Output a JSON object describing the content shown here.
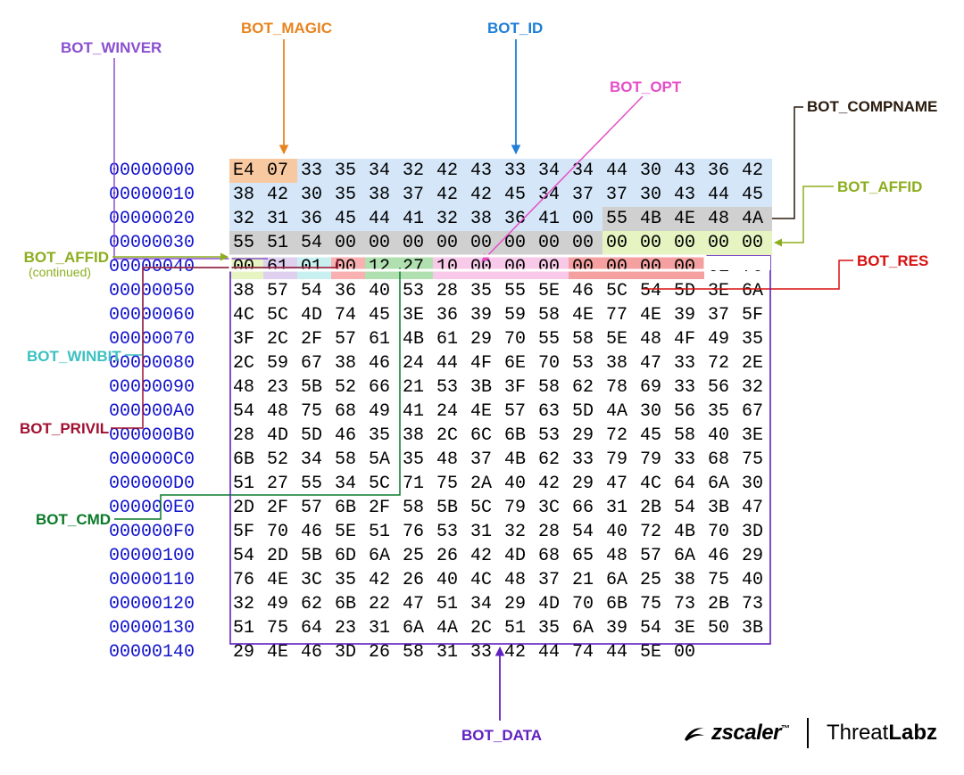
{
  "labels": {
    "bot_magic": "BOT_MAGIC",
    "bot_id": "BOT_ID",
    "bot_winver": "BOT_WINVER",
    "bot_opt": "BOT_OPT",
    "bot_compname": "BOT_COMPNAME",
    "bot_affid": "BOT_AFFID",
    "bot_affid2": "BOT_AFFID",
    "bot_affid2_sub": "(continued)",
    "bot_winbit": "BOT_WINBIT",
    "bot_privil": "BOT_PRIVIL",
    "bot_cmd": "BOT_CMD",
    "bot_res": "BOT_RES",
    "bot_data": "BOT_DATA"
  },
  "colors": {
    "magic": "#e88420",
    "id": "#1e7ed8",
    "winver": "#8a4fd0",
    "opt": "#e64fc8",
    "compname": "#2a1a0d",
    "affid": "#8cae1e",
    "winbit": "#3cc0c0",
    "privil": "#a01030",
    "cmd": "#0a7a2a",
    "res": "#d81010",
    "data": "#6020c0"
  },
  "rows": [
    {
      "off": "00000000",
      "b": [
        "E4",
        "07",
        "33",
        "35",
        "34",
        "32",
        "42",
        "43",
        "33",
        "34",
        "34",
        "44",
        "30",
        "43",
        "36",
        "42"
      ]
    },
    {
      "off": "00000010",
      "b": [
        "38",
        "42",
        "30",
        "35",
        "38",
        "37",
        "42",
        "42",
        "45",
        "34",
        "37",
        "37",
        "30",
        "43",
        "44",
        "45"
      ]
    },
    {
      "off": "00000020",
      "b": [
        "32",
        "31",
        "36",
        "45",
        "44",
        "41",
        "32",
        "38",
        "36",
        "41",
        "00",
        "55",
        "4B",
        "4E",
        "48",
        "4A"
      ]
    },
    {
      "off": "00000030",
      "b": [
        "55",
        "51",
        "54",
        "00",
        "00",
        "00",
        "00",
        "00",
        "00",
        "00",
        "00",
        "00",
        "00",
        "00",
        "00",
        "00"
      ]
    },
    {
      "off": "00000040",
      "b": [
        "00",
        "61",
        "01",
        "00",
        "12",
        "27",
        "10",
        "00",
        "00",
        "00",
        "00",
        "00",
        "00",
        "00",
        "6E",
        "70"
      ]
    },
    {
      "off": "00000050",
      "b": [
        "38",
        "57",
        "54",
        "36",
        "40",
        "53",
        "28",
        "35",
        "55",
        "5E",
        "46",
        "5C",
        "54",
        "5D",
        "3E",
        "6A"
      ]
    },
    {
      "off": "00000060",
      "b": [
        "4C",
        "5C",
        "4D",
        "74",
        "45",
        "3E",
        "36",
        "39",
        "59",
        "58",
        "4E",
        "77",
        "4E",
        "39",
        "37",
        "5F"
      ]
    },
    {
      "off": "00000070",
      "b": [
        "3F",
        "2C",
        "2F",
        "57",
        "61",
        "4B",
        "61",
        "29",
        "70",
        "55",
        "58",
        "5E",
        "48",
        "4F",
        "49",
        "35"
      ]
    },
    {
      "off": "00000080",
      "b": [
        "2C",
        "59",
        "67",
        "38",
        "46",
        "24",
        "44",
        "4F",
        "6E",
        "70",
        "53",
        "38",
        "47",
        "33",
        "72",
        "2E"
      ]
    },
    {
      "off": "00000090",
      "b": [
        "48",
        "23",
        "5B",
        "52",
        "66",
        "21",
        "53",
        "3B",
        "3F",
        "58",
        "62",
        "78",
        "69",
        "33",
        "56",
        "32"
      ]
    },
    {
      "off": "000000A0",
      "b": [
        "54",
        "48",
        "75",
        "68",
        "49",
        "41",
        "24",
        "4E",
        "57",
        "63",
        "5D",
        "4A",
        "30",
        "56",
        "35",
        "67"
      ]
    },
    {
      "off": "000000B0",
      "b": [
        "28",
        "4D",
        "5D",
        "46",
        "35",
        "38",
        "2C",
        "6C",
        "6B",
        "53",
        "29",
        "72",
        "45",
        "58",
        "40",
        "3E"
      ]
    },
    {
      "off": "000000C0",
      "b": [
        "6B",
        "52",
        "34",
        "58",
        "5A",
        "35",
        "48",
        "37",
        "4B",
        "62",
        "33",
        "79",
        "79",
        "33",
        "68",
        "75"
      ]
    },
    {
      "off": "000000D0",
      "b": [
        "51",
        "27",
        "55",
        "34",
        "5C",
        "71",
        "75",
        "2A",
        "40",
        "42",
        "29",
        "47",
        "4C",
        "64",
        "6A",
        "30"
      ]
    },
    {
      "off": "000000E0",
      "b": [
        "2D",
        "2F",
        "57",
        "6B",
        "2F",
        "58",
        "5B",
        "5C",
        "79",
        "3C",
        "66",
        "31",
        "2B",
        "54",
        "3B",
        "47"
      ]
    },
    {
      "off": "000000F0",
      "b": [
        "5F",
        "70",
        "46",
        "5E",
        "51",
        "76",
        "53",
        "31",
        "32",
        "28",
        "54",
        "40",
        "72",
        "4B",
        "70",
        "3D"
      ]
    },
    {
      "off": "00000100",
      "b": [
        "54",
        "2D",
        "5B",
        "6D",
        "6A",
        "25",
        "26",
        "42",
        "4D",
        "68",
        "65",
        "48",
        "57",
        "6A",
        "46",
        "29"
      ]
    },
    {
      "off": "00000110",
      "b": [
        "76",
        "4E",
        "3C",
        "35",
        "42",
        "26",
        "40",
        "4C",
        "48",
        "37",
        "21",
        "6A",
        "25",
        "38",
        "75",
        "40"
      ]
    },
    {
      "off": "00000120",
      "b": [
        "32",
        "49",
        "62",
        "6B",
        "22",
        "47",
        "51",
        "34",
        "29",
        "4D",
        "70",
        "6B",
        "75",
        "73",
        "2B",
        "73"
      ]
    },
    {
      "off": "00000130",
      "b": [
        "51",
        "75",
        "64",
        "23",
        "31",
        "6A",
        "4A",
        "2C",
        "51",
        "35",
        "6A",
        "39",
        "54",
        "3E",
        "50",
        "3B"
      ]
    },
    {
      "off": "00000140",
      "b": [
        "29",
        "4E",
        "46",
        "3D",
        "26",
        "58",
        "31",
        "33",
        "42",
        "44",
        "74",
        "44",
        "5E",
        "00",
        "",
        ""
      ]
    }
  ],
  "footer": {
    "brand1": "zscaler",
    "brand2a": "Threat",
    "brand2b": "Labz"
  }
}
